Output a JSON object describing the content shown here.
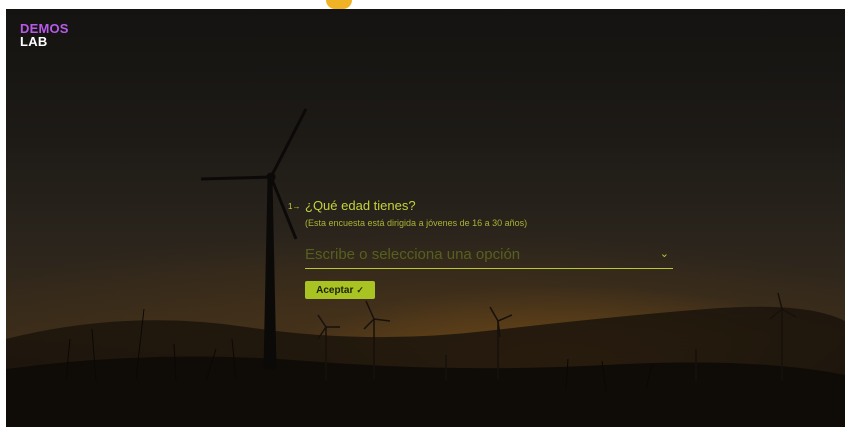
{
  "brand": {
    "logo_line1": "DEMOS",
    "logo_line2": "LAB"
  },
  "question": {
    "number": "1",
    "arrow": "→",
    "title": "¿Qué edad tienes?",
    "hint": "(Esta encuesta está dirigida a jóvenes de 16 a 30 años)"
  },
  "answer": {
    "placeholder": "Escribe o selecciona una opción",
    "value": "",
    "chevron_icon": "chevron-down-icon"
  },
  "submit": {
    "label": "Aceptar",
    "check": "✓"
  },
  "colors": {
    "accent": "#c4d43a",
    "button": "#a9c322",
    "logo_purple": "#b65ae8",
    "top_accent": "#f0b325"
  }
}
